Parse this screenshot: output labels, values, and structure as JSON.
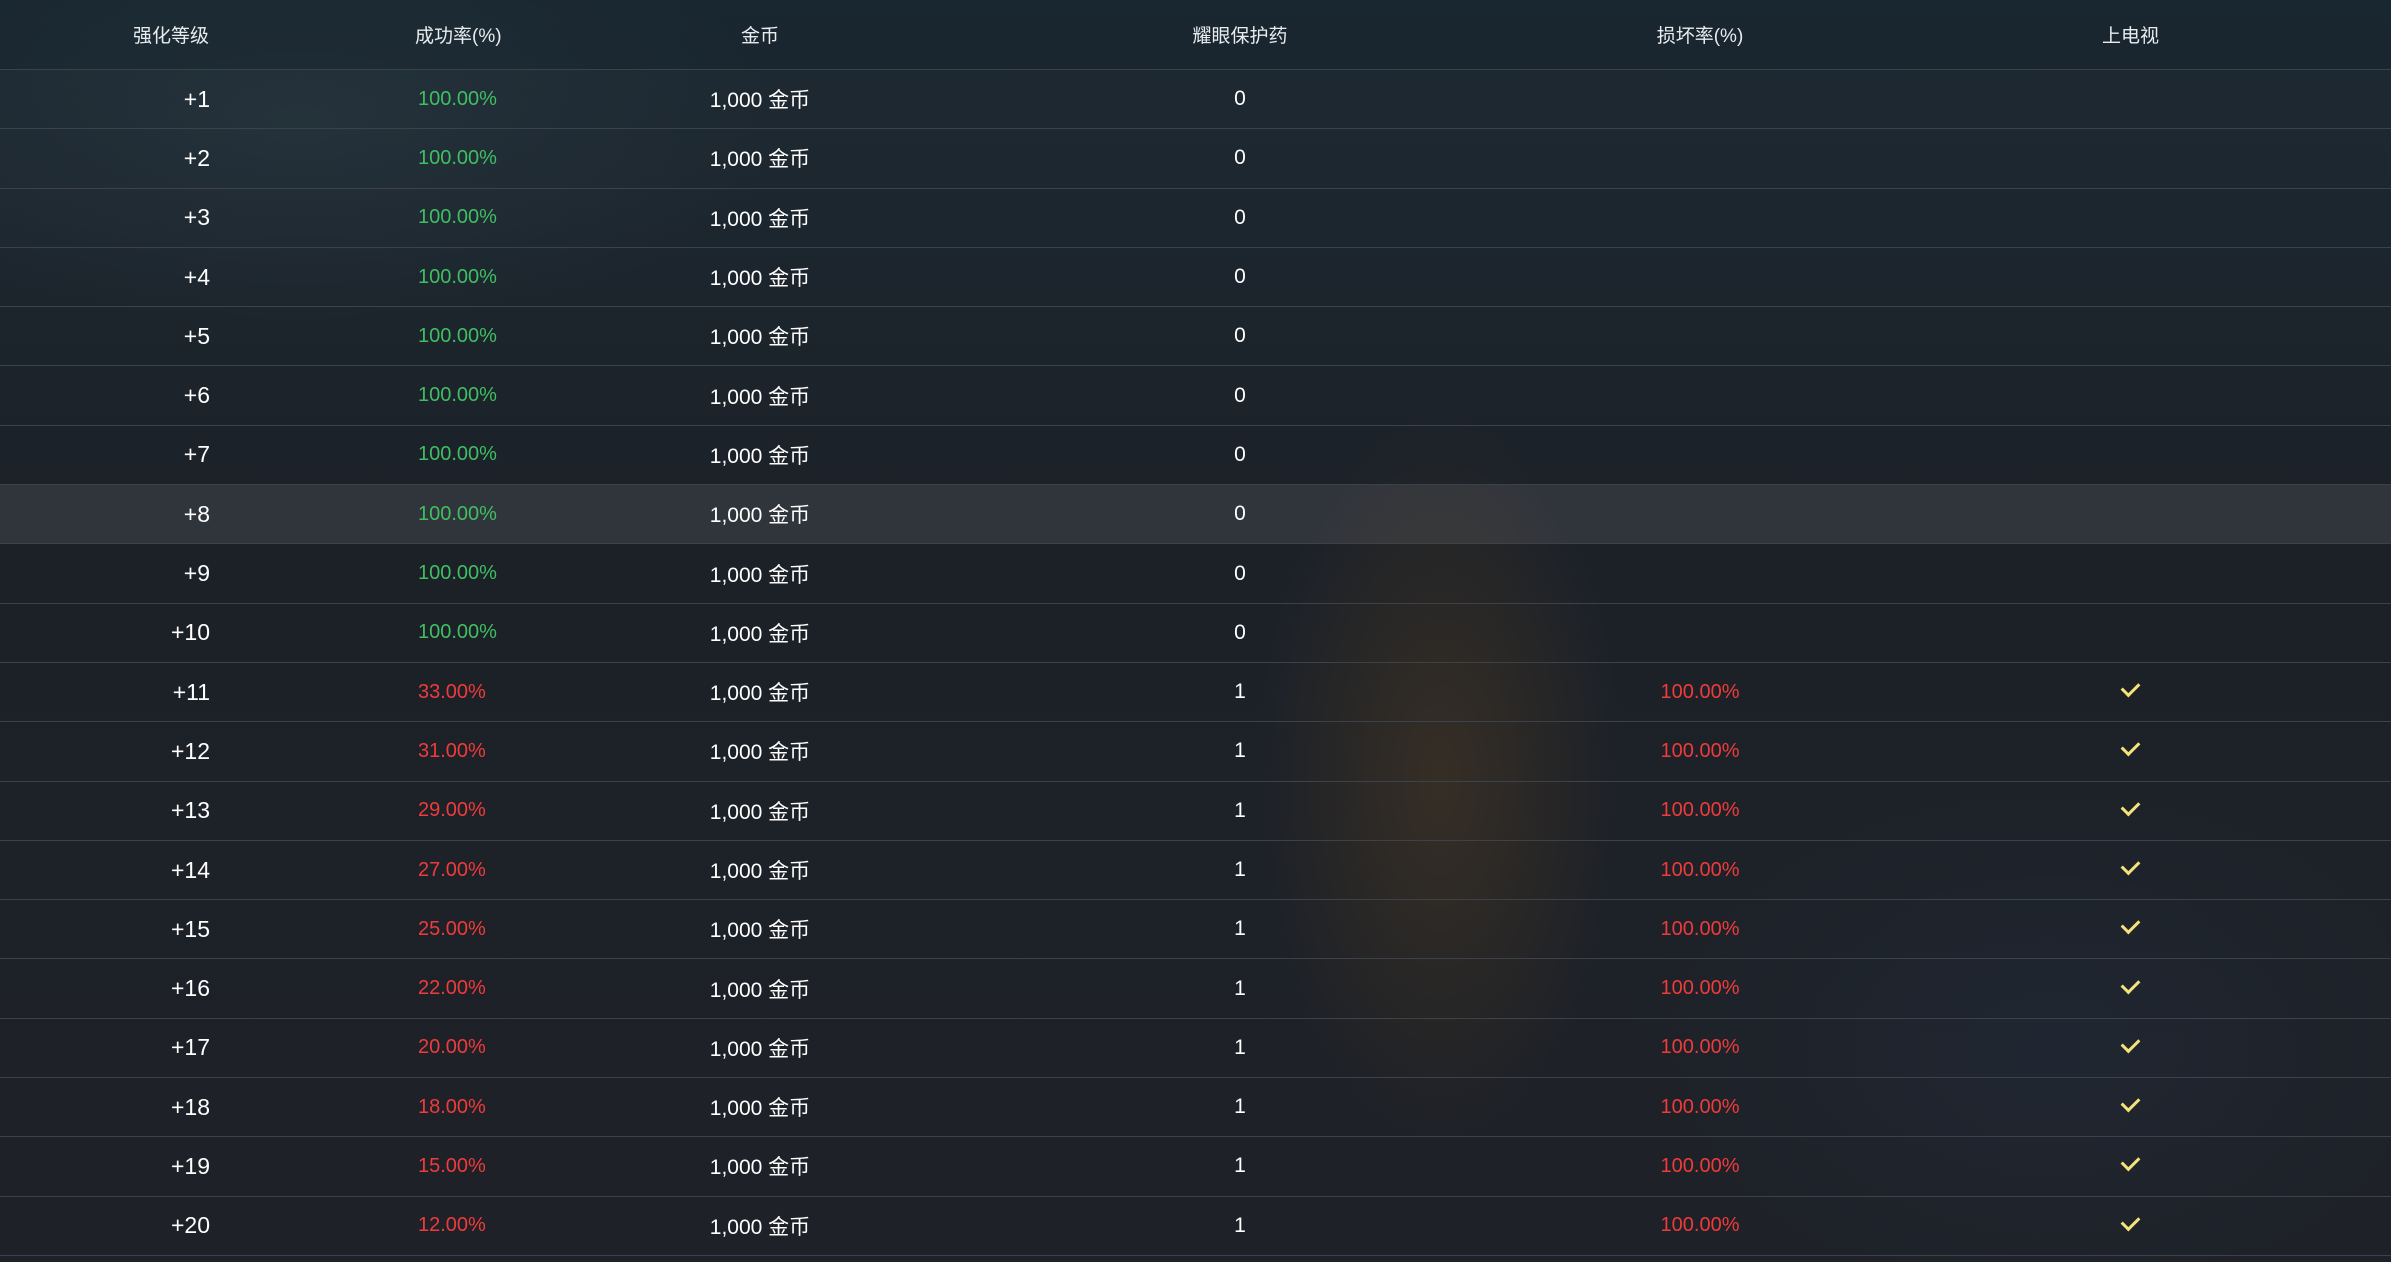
{
  "headers": {
    "level": "强化等级",
    "success_rate": "成功率(%)",
    "gold": "金币",
    "protection": "耀眼保护药",
    "break_rate": "损坏率(%)",
    "tv": "上电视"
  },
  "colors": {
    "success_green": "#3fbf62",
    "danger_red": "#ef3b3b",
    "check_yellow": "#f6e27a"
  },
  "rows": [
    {
      "level": "+1",
      "success_rate": "100.00%",
      "gold": "1,000 金币",
      "protection": "0",
      "break_rate": "",
      "tv": false
    },
    {
      "level": "+2",
      "success_rate": "100.00%",
      "gold": "1,000 金币",
      "protection": "0",
      "break_rate": "",
      "tv": false
    },
    {
      "level": "+3",
      "success_rate": "100.00%",
      "gold": "1,000 金币",
      "protection": "0",
      "break_rate": "",
      "tv": false
    },
    {
      "level": "+4",
      "success_rate": "100.00%",
      "gold": "1,000 金币",
      "protection": "0",
      "break_rate": "",
      "tv": false
    },
    {
      "level": "+5",
      "success_rate": "100.00%",
      "gold": "1,000 金币",
      "protection": "0",
      "break_rate": "",
      "tv": false
    },
    {
      "level": "+6",
      "success_rate": "100.00%",
      "gold": "1,000 金币",
      "protection": "0",
      "break_rate": "",
      "tv": false
    },
    {
      "level": "+7",
      "success_rate": "100.00%",
      "gold": "1,000 金币",
      "protection": "0",
      "break_rate": "",
      "tv": false
    },
    {
      "level": "+8",
      "success_rate": "100.00%",
      "gold": "1,000 金币",
      "protection": "0",
      "break_rate": "",
      "tv": false,
      "highlighted": true
    },
    {
      "level": "+9",
      "success_rate": "100.00%",
      "gold": "1,000 金币",
      "protection": "0",
      "break_rate": "",
      "tv": false
    },
    {
      "level": "+10",
      "success_rate": "100.00%",
      "gold": "1,000 金币",
      "protection": "0",
      "break_rate": "",
      "tv": false
    },
    {
      "level": "+11",
      "success_rate": "33.00%",
      "gold": "1,000 金币",
      "protection": "1",
      "break_rate": "100.00%",
      "tv": true
    },
    {
      "level": "+12",
      "success_rate": "31.00%",
      "gold": "1,000 金币",
      "protection": "1",
      "break_rate": "100.00%",
      "tv": true
    },
    {
      "level": "+13",
      "success_rate": "29.00%",
      "gold": "1,000 金币",
      "protection": "1",
      "break_rate": "100.00%",
      "tv": true
    },
    {
      "level": "+14",
      "success_rate": "27.00%",
      "gold": "1,000 金币",
      "protection": "1",
      "break_rate": "100.00%",
      "tv": true
    },
    {
      "level": "+15",
      "success_rate": "25.00%",
      "gold": "1,000 金币",
      "protection": "1",
      "break_rate": "100.00%",
      "tv": true
    },
    {
      "level": "+16",
      "success_rate": "22.00%",
      "gold": "1,000 金币",
      "protection": "1",
      "break_rate": "100.00%",
      "tv": true
    },
    {
      "level": "+17",
      "success_rate": "20.00%",
      "gold": "1,000 金币",
      "protection": "1",
      "break_rate": "100.00%",
      "tv": true
    },
    {
      "level": "+18",
      "success_rate": "18.00%",
      "gold": "1,000 金币",
      "protection": "1",
      "break_rate": "100.00%",
      "tv": true
    },
    {
      "level": "+19",
      "success_rate": "15.00%",
      "gold": "1,000 金币",
      "protection": "1",
      "break_rate": "100.00%",
      "tv": true
    },
    {
      "level": "+20",
      "success_rate": "12.00%",
      "gold": "1,000 金币",
      "protection": "1",
      "break_rate": "100.00%",
      "tv": true
    }
  ]
}
